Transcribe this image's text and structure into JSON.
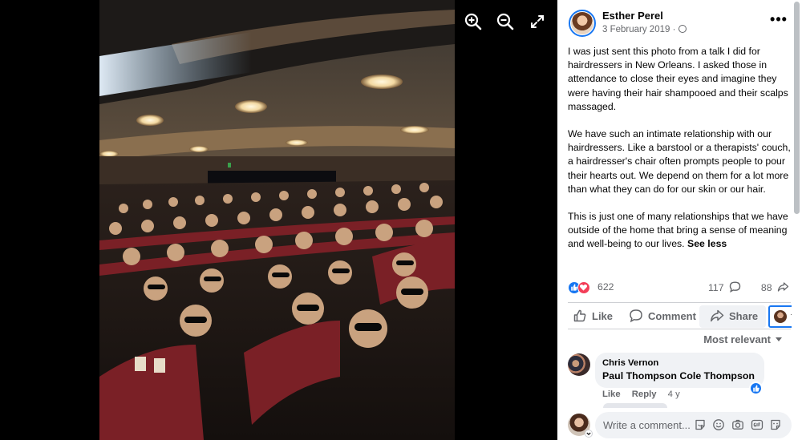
{
  "post": {
    "author_name": "Esther Perel",
    "date": "3 February 2019 ·",
    "more_label": "•••",
    "paragraphs": [
      "I was just sent this photo from a talk I did for hairdressers in New Orleans. I asked those in attendance to close their eyes and imagine they were having their hair shampooed and their scalps massaged.",
      "We have such an intimate relationship with our hairdressers. Like a barstool or a therapists' couch, a hairdresser's chair often prompts people to pour their hearts out. We depend on them for a lot more than what they can do for our skin or our hair.",
      "This is just one of many relationships that we have outside of the home that bring a sense of meaning and well-being to our lives."
    ],
    "see_less_label": "See less"
  },
  "stats": {
    "reactions_count": "622",
    "comments_count": "117",
    "shares_count": "88"
  },
  "actions": {
    "like_label": "Like",
    "comment_label": "Comment",
    "share_label": "Share"
  },
  "comments_section": {
    "sort_label": "Most relevant",
    "comment": {
      "author": "Chris Vernon",
      "text": "Paul Thompson Cole Thompson",
      "like_label": "Like",
      "reply_label": "Reply",
      "time": "4 y"
    },
    "input_placeholder": "Write a comment..."
  },
  "icons": {
    "zoom_in": "zoom-in-icon",
    "zoom_out": "zoom-out-icon",
    "fullscreen": "fullscreen-icon",
    "globe": "globe-icon",
    "like": "thumbs-up-icon",
    "comment": "comment-bubble-icon",
    "share": "share-arrow-icon",
    "sticker": "sticker-icon",
    "emoji": "emoji-icon",
    "camera": "camera-icon",
    "gif": "gif-icon"
  },
  "colors": {
    "accent": "#1877f2",
    "love": "#f33e58",
    "text_primary": "#050505",
    "text_secondary": "#65676b",
    "bubble_bg": "#f0f2f5"
  }
}
